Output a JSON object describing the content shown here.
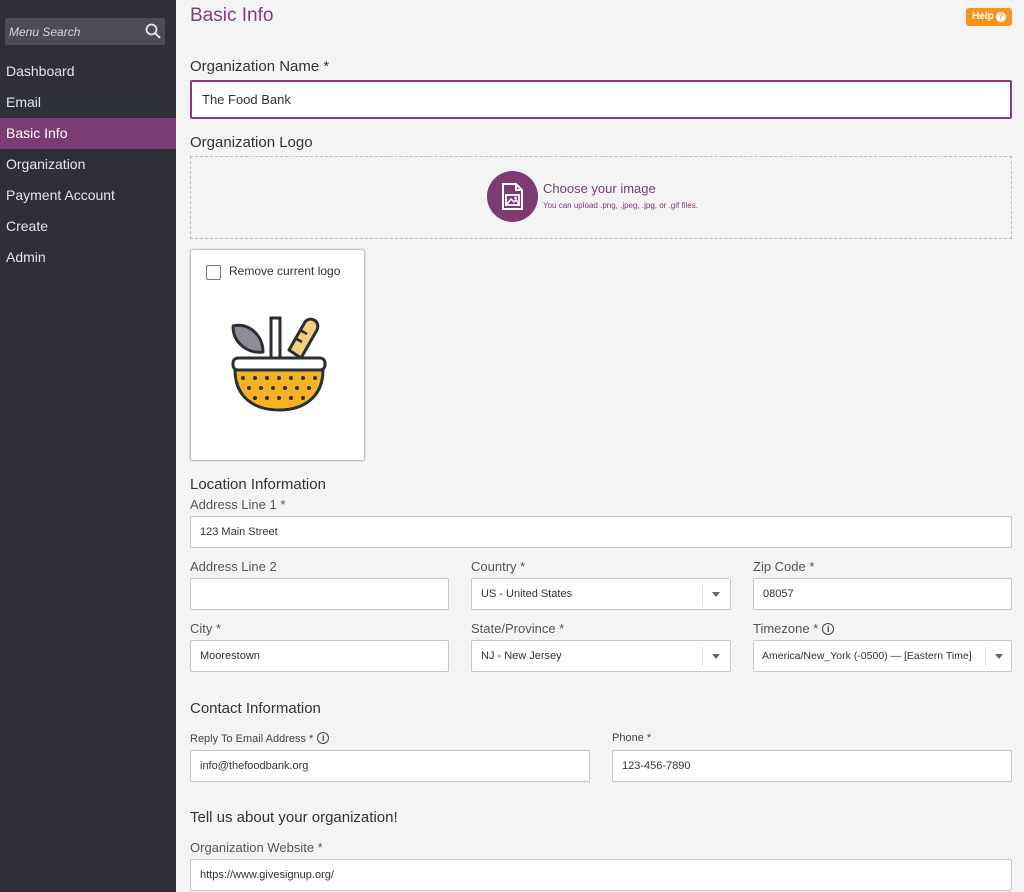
{
  "sidebar": {
    "search_placeholder": "Menu Search",
    "items": [
      {
        "label": "Dashboard"
      },
      {
        "label": "Email"
      },
      {
        "label": "Basic Info"
      },
      {
        "label": "Organization"
      },
      {
        "label": "Payment Account"
      },
      {
        "label": "Create"
      },
      {
        "label": "Admin"
      }
    ],
    "active": "Basic Info"
  },
  "header": {
    "title": "Basic Info",
    "help_label": "Help"
  },
  "org": {
    "name_label": "Organization Name *",
    "name_value": "The Food Bank",
    "logo_label": "Organization Logo",
    "upload_title": "Choose your image",
    "upload_hint": "You can upload .png, .jpeg, .jpg, or .gif files.",
    "remove_logo_label": "Remove current logo"
  },
  "location": {
    "heading": "Location Information",
    "address1_label": "Address Line 1 *",
    "address1_value": "123 Main Street",
    "address2_label": "Address Line 2",
    "address2_value": "",
    "country_label": "Country *",
    "country_value": "US - United States",
    "zip_label": "Zip Code *",
    "zip_value": "08057",
    "city_label": "City *",
    "city_value": "Moorestown",
    "state_label": "State/Province *",
    "state_value": "NJ - New Jersey",
    "timezone_label": "Timezone *",
    "timezone_value": "America/New_York (-0500) — [Eastern Time]"
  },
  "contact": {
    "heading": "Contact Information",
    "email_label": "Reply To Email Address *",
    "email_value": "info@thefoodbank.org",
    "phone_label": "Phone *",
    "phone_value": "123-456-7890"
  },
  "about": {
    "heading": "Tell us about your organization!",
    "website_label": "Organization Website *",
    "website_value": "https://www.givesignup.org/"
  },
  "colors": {
    "brand": "#7c3b72",
    "sidebar": "#2d3038",
    "help": "#f7941d"
  }
}
